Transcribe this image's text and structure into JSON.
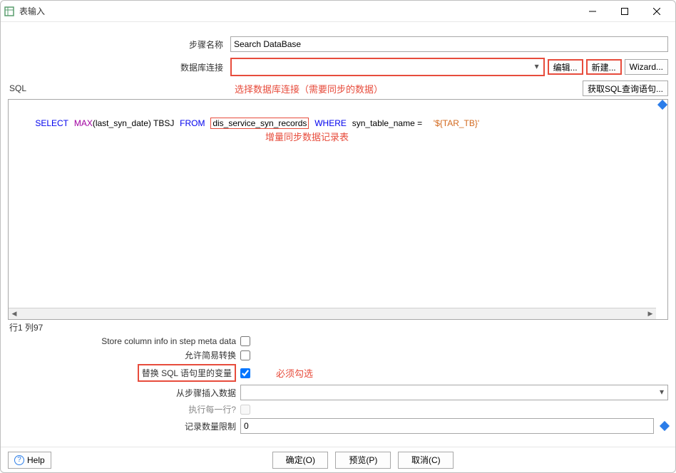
{
  "title": "表输入",
  "labels": {
    "step_name": "步骤名称",
    "db_connection": "数据库连接",
    "sql": "SQL",
    "edit": "编辑...",
    "new": "新建...",
    "wizard": "Wizard...",
    "get_sql": "获取SQL查询语句...",
    "caret": "行1 列97",
    "store_col": "Store column info in step meta data",
    "allow_lazy": "允许简易转换",
    "replace_var": "替换 SQL 语句里的变量",
    "insert_from": "从步骤插入数据",
    "exec_each": "执行每一行?",
    "record_limit": "记录数量限制",
    "help": "Help",
    "ok": "确定(O)",
    "preview": "预览(P)",
    "cancel": "取消(C)"
  },
  "values": {
    "step_name": "Search DataBase",
    "db_connection": "",
    "record_limit": "0"
  },
  "sql": {
    "select": "SELECT",
    "max": "MAX",
    "arg": "(last_syn_date) TBSJ",
    "from": "FROM",
    "table": "dis_service_syn_records",
    "where": "WHERE",
    "cond": "syn_table_name =",
    "literal": "'${TAR_TB}'"
  },
  "annotations": {
    "db": "选择数据库连接（需要同步的数据）",
    "sql": "增量同步数据记录表",
    "replace": "必须勾选"
  }
}
